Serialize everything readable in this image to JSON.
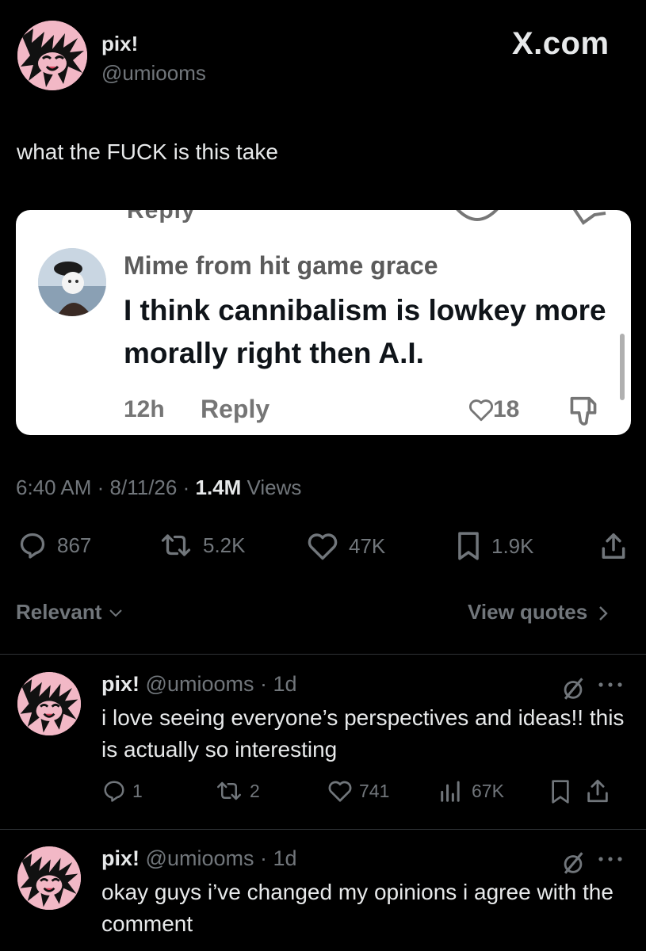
{
  "post": {
    "display_name": "pix!",
    "handle": "@umiooms",
    "watermark": "X.com",
    "text": "what the FUCK is this take",
    "time": "6:40 AM",
    "date": "8/11/26",
    "views_count": "1.4M",
    "views_label": "Views",
    "stats": {
      "replies": "867",
      "reposts": "5.2K",
      "likes": "47K",
      "bookmarks": "1.9K"
    }
  },
  "quoted_screenshot": {
    "top_cut_text": "Reply",
    "commenter_name": "Mime from hit game grace",
    "comment_text": "I think cannibalism is lowkey more morally right then A.I.",
    "time_ago": "12h",
    "reply_label": "Reply",
    "like_count": "18"
  },
  "sort": {
    "relevant_label": "Relevant",
    "view_quotes_label": "View quotes"
  },
  "replies": [
    {
      "display_name": "pix!",
      "handle": "@umiooms",
      "separator": "·",
      "age": "1d",
      "text": "i love seeing everyone’s perspectives and ideas!! this is actually so interesting",
      "stats": {
        "replies": "1",
        "reposts": "2",
        "likes": "741",
        "views": "67K"
      }
    },
    {
      "display_name": "pix!",
      "handle": "@umiooms",
      "separator": "·",
      "age": "1d",
      "text": "okay guys i’ve changed my opinions i agree with the comment"
    }
  ],
  "colors": {
    "background": "#000000",
    "text_primary": "#e7e9ea",
    "text_secondary": "#71767b",
    "divider": "#2f3336",
    "avatar_pink": "#f2b8c6",
    "card_background": "#ffffff"
  },
  "icons": [
    "reply-icon",
    "repost-icon",
    "like-icon",
    "bookmark-icon",
    "share-icon",
    "views-icon",
    "chevron-down-icon",
    "chevron-right-icon",
    "more-icon",
    "grok-slash-icon",
    "heart-outline-icon",
    "dislike-icon"
  ]
}
